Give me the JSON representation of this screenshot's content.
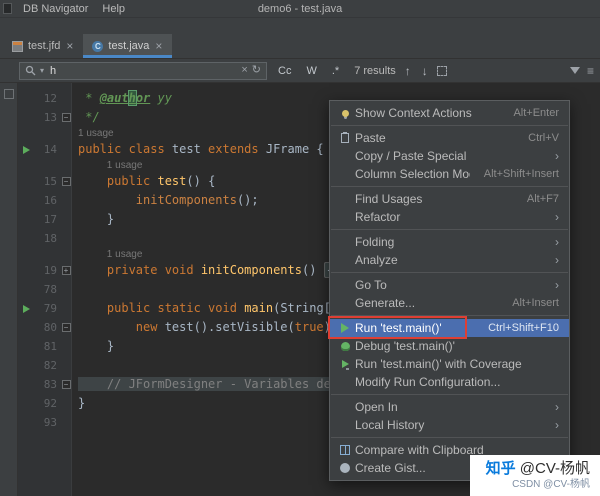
{
  "titlebar": {
    "menus": [
      {
        "label": "DB Navigator"
      },
      {
        "label": "Help"
      }
    ],
    "title": "demo6 - test.java"
  },
  "tabs": [
    {
      "label": "test.jfd",
      "icon": "form-file-icon",
      "active": false
    },
    {
      "label": "test.java",
      "icon": "java-class-icon",
      "active": true
    }
  ],
  "findbar": {
    "query": "h",
    "toggles": {
      "match_case": "Cc",
      "words": "W",
      "regex": ".*"
    },
    "results": "7 results"
  },
  "editor": {
    "rows": [
      {
        "type": "code",
        "num": "12",
        "tokens": [
          [
            "doc",
            " * "
          ],
          [
            "doctag",
            "@aut"
          ],
          [
            "doctag hl",
            "h"
          ],
          [
            "doctag",
            "or"
          ],
          [
            "doc",
            " yy"
          ]
        ]
      },
      {
        "type": "code",
        "num": "13",
        "fold": "minus",
        "tokens": [
          [
            "doc",
            " */"
          ]
        ]
      },
      {
        "type": "usage",
        "label": "1 usage",
        "indent": 0
      },
      {
        "type": "code",
        "num": "14",
        "run": true,
        "tokens": [
          [
            "kw",
            "public class "
          ],
          [
            "plain",
            "test "
          ],
          [
            "kw",
            "extends "
          ],
          [
            "plain",
            "JFrame {"
          ]
        ]
      },
      {
        "type": "usage",
        "label": "1 usage",
        "indent": 4
      },
      {
        "type": "code",
        "num": "15",
        "fold": "minus",
        "tokens": [
          [
            "plain",
            "    "
          ],
          [
            "kw",
            "public "
          ],
          [
            "method",
            "test"
          ],
          [
            "plain",
            "() {"
          ]
        ]
      },
      {
        "type": "code",
        "num": "16",
        "tokens": [
          [
            "plain",
            "        "
          ],
          [
            "call",
            "initComponents"
          ],
          [
            "plain",
            "();"
          ]
        ]
      },
      {
        "type": "code",
        "num": "17",
        "tokens": [
          [
            "plain",
            "    }"
          ]
        ]
      },
      {
        "type": "code",
        "num": "18",
        "tokens": []
      },
      {
        "type": "usage",
        "label": "1 usage",
        "indent": 4
      },
      {
        "type": "code",
        "num": "19",
        "fold": "plus",
        "tokens": [
          [
            "plain",
            "    "
          ],
          [
            "kw",
            "private void "
          ],
          [
            "method",
            "initComponents"
          ],
          [
            "plain",
            "() "
          ],
          [
            "fold-region",
            "{...}"
          ]
        ]
      },
      {
        "type": "code",
        "num": "78",
        "tokens": []
      },
      {
        "type": "code",
        "num": "79",
        "run": true,
        "tokens": [
          [
            "plain",
            "    "
          ],
          [
            "kw",
            "public static void "
          ],
          [
            "method",
            "main"
          ],
          [
            "plain",
            "(String[] args)"
          ]
        ]
      },
      {
        "type": "code",
        "num": "80",
        "fold": "minus",
        "tokens": [
          [
            "plain",
            "        "
          ],
          [
            "kw",
            "new "
          ],
          [
            "plain",
            "test().setVisible("
          ],
          [
            "kw",
            "true"
          ],
          [
            "plain",
            ");"
          ]
        ]
      },
      {
        "type": "code",
        "num": "81",
        "tokens": [
          [
            "plain",
            "    }"
          ]
        ]
      },
      {
        "type": "code",
        "num": "82",
        "tokens": []
      },
      {
        "type": "code",
        "num": "83",
        "fold": "minus",
        "tokens": [
          [
            "comment dim-bg",
            "    // JFormDesigner - Variables declarati"
          ]
        ]
      },
      {
        "type": "code",
        "num": "92",
        "tokens": [
          [
            "plain",
            "}"
          ]
        ]
      },
      {
        "type": "code",
        "num": "93",
        "tokens": []
      }
    ]
  },
  "context_menu": {
    "items": [
      {
        "label": "Show Context Actions",
        "shortcut": "Alt+Enter",
        "icon": "context-actions-icon"
      },
      {
        "separator": true
      },
      {
        "label": "Paste",
        "shortcut": "Ctrl+V",
        "icon": "paste-icon"
      },
      {
        "label": "Copy / Paste Special",
        "submenu": true
      },
      {
        "label": "Column Selection Mode",
        "shortcut": "Alt+Shift+Insert"
      },
      {
        "separator": true
      },
      {
        "label": "Find Usages",
        "shortcut": "Alt+F7"
      },
      {
        "label": "Refactor",
        "submenu": true
      },
      {
        "separator": true
      },
      {
        "label": "Folding",
        "submenu": true
      },
      {
        "label": "Analyze",
        "submenu": true
      },
      {
        "separator": true
      },
      {
        "label": "Go To",
        "submenu": true
      },
      {
        "label": "Generate...",
        "shortcut": "Alt+Insert"
      },
      {
        "separator": true
      },
      {
        "label": "Run 'test.main()'",
        "shortcut": "Ctrl+Shift+F10",
        "icon": "run-icon",
        "selected": true,
        "red_box": true
      },
      {
        "label": "Debug 'test.main()'",
        "icon": "debug-icon"
      },
      {
        "label": "Run 'test.main()' with Coverage",
        "icon": "coverage-icon"
      },
      {
        "label": "Modify Run Configuration..."
      },
      {
        "separator": true
      },
      {
        "label": "Open In",
        "submenu": true
      },
      {
        "label": "Local History",
        "submenu": true
      },
      {
        "separator": true
      },
      {
        "label": "Compare with Clipboard",
        "icon": "diff-icon"
      },
      {
        "label": "Create Gist...",
        "icon": "gist-icon"
      }
    ]
  },
  "watermark": {
    "line1_brand": "知乎",
    "line1_user": " @CV-杨帆",
    "line2": "CSDN @CV-杨帆"
  },
  "colors": {
    "accent_blue": "#4b6eaf",
    "run_green": "#5cad5c",
    "red_box": "#de3f34",
    "tab_underline": "#4a88c7",
    "search_match": "#32593d"
  }
}
